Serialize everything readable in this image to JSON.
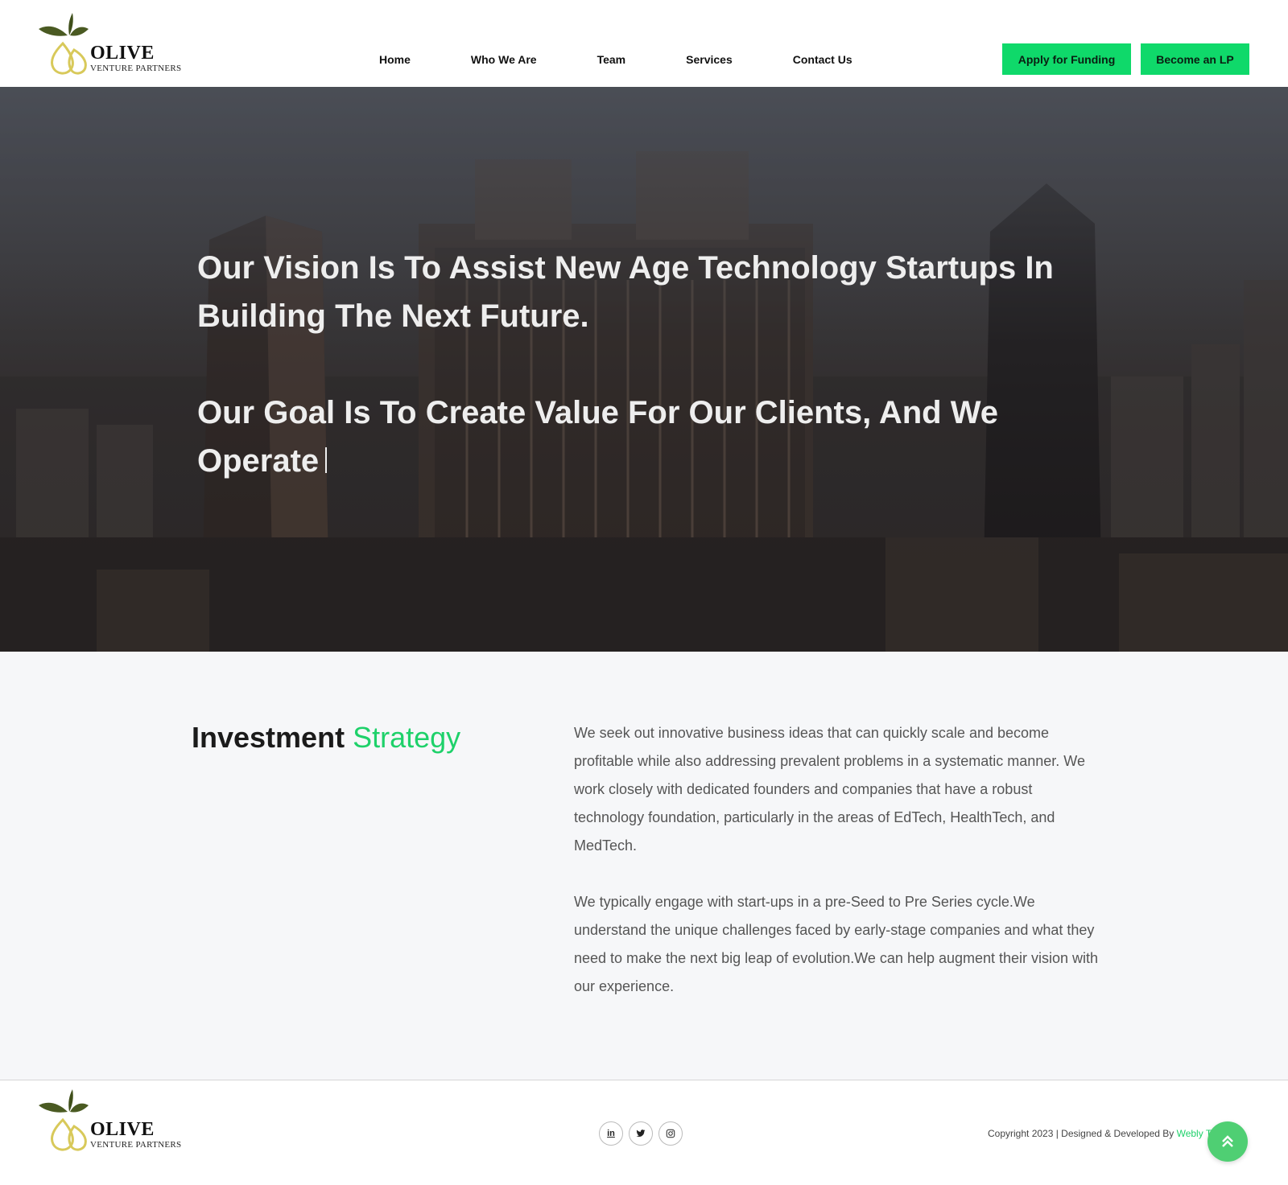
{
  "brand": {
    "name": "OLIVE",
    "tagline": "VENTURE PARTNERS"
  },
  "nav": {
    "items": [
      "Home",
      "Who We Are",
      "Team",
      "Services",
      "Contact Us"
    ]
  },
  "header": {
    "apply_label": "Apply for Funding",
    "lp_label": "Become an LP"
  },
  "hero": {
    "line1": "Our Vision Is To Assist New Age Technology Startups In Building The Next Future.",
    "line2": "Our Goal Is To Create Value For Our Clients, And We Operate"
  },
  "strategy": {
    "title_main": "Investment",
    "title_accent": "Strategy",
    "paragraph1": "We seek out innovative business ideas that can quickly scale and become profitable while also addressing prevalent problems in a systematic manner. We work closely with dedicated founders and companies that have a robust technology foundation, particularly in the areas of EdTech, HealthTech, and MedTech.",
    "paragraph2": "We typically engage with start-ups in a pre-Seed to Pre Series cycle.We understand the unique challenges faced by early-stage companies and what they need to make the next big leap of evolution.We can help augment their vision with our experience."
  },
  "footer": {
    "socials": [
      "in",
      "twitter",
      "instagram"
    ],
    "copyright_prefix": "Copyright 2023 | Designed & Developed By ",
    "copyright_brand": "Webly Tech Lab"
  },
  "colors": {
    "accent": "#0fd96a",
    "accent_text": "#1ed16a",
    "scroll_button": "#4fcf73",
    "leaf": "#4a5a22",
    "olive_drop": "#d8c95a"
  },
  "icons": {
    "scroll_top": "double-chevron-up-icon",
    "linkedin": "linkedin-icon",
    "twitter": "twitter-icon",
    "instagram": "instagram-icon"
  }
}
